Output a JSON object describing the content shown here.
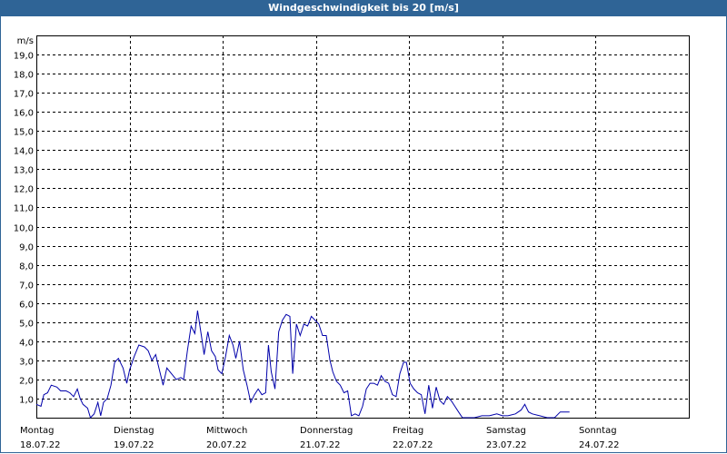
{
  "chart_data": {
    "type": "line",
    "title": "Windgeschwindigkeit bis 20 [m/s]",
    "ylabel": "m/s",
    "ylim": [
      0,
      20
    ],
    "yticks": [
      "1,0",
      "2,0",
      "3,0",
      "4,0",
      "5,0",
      "6,0",
      "7,0",
      "8,0",
      "9,0",
      "10,0",
      "11,0",
      "12,0",
      "13,0",
      "14,0",
      "15,0",
      "16,0",
      "17,0",
      "18,0",
      "19,0"
    ],
    "xlim": [
      0,
      7
    ],
    "x_categories": [
      {
        "day": "Montag",
        "date": "18.07.22"
      },
      {
        "day": "Dienstag",
        "date": "19.07.22"
      },
      {
        "day": "Mittwoch",
        "date": "20.07.22"
      },
      {
        "day": "Donnerstag",
        "date": "21.07.22"
      },
      {
        "day": "Freitag",
        "date": "22.07.22"
      },
      {
        "day": "Samstag",
        "date": "23.07.22"
      },
      {
        "day": "Sonntag",
        "date": "24.07.22"
      }
    ],
    "grid": true,
    "line_color": "#0000aa",
    "series": [
      {
        "x_unit": "days since Montag 18.07.22",
        "points": [
          [
            0.0,
            0.7
          ],
          [
            0.05,
            0.6
          ],
          [
            0.08,
            1.2
          ],
          [
            0.12,
            1.3
          ],
          [
            0.16,
            1.7
          ],
          [
            0.22,
            1.6
          ],
          [
            0.26,
            1.4
          ],
          [
            0.32,
            1.4
          ],
          [
            0.36,
            1.3
          ],
          [
            0.4,
            1.1
          ],
          [
            0.44,
            1.5
          ],
          [
            0.47,
            1.0
          ],
          [
            0.5,
            0.7
          ],
          [
            0.55,
            0.5
          ],
          [
            0.58,
            0.0
          ],
          [
            0.62,
            0.2
          ],
          [
            0.66,
            0.8
          ],
          [
            0.69,
            0.1
          ],
          [
            0.72,
            0.8
          ],
          [
            0.76,
            1.0
          ],
          [
            0.8,
            1.7
          ],
          [
            0.84,
            2.9
          ],
          [
            0.88,
            3.1
          ],
          [
            0.93,
            2.6
          ],
          [
            0.97,
            1.8
          ],
          [
            1.0,
            2.5
          ],
          [
            1.05,
            3.2
          ],
          [
            1.1,
            3.8
          ],
          [
            1.16,
            3.7
          ],
          [
            1.2,
            3.5
          ],
          [
            1.24,
            3.0
          ],
          [
            1.28,
            3.3
          ],
          [
            1.32,
            2.5
          ],
          [
            1.36,
            1.7
          ],
          [
            1.4,
            2.6
          ],
          [
            1.45,
            2.3
          ],
          [
            1.5,
            2.0
          ],
          [
            1.55,
            2.1
          ],
          [
            1.58,
            2.0
          ],
          [
            1.62,
            3.5
          ],
          [
            1.66,
            4.8
          ],
          [
            1.7,
            4.4
          ],
          [
            1.73,
            5.6
          ],
          [
            1.77,
            4.3
          ],
          [
            1.8,
            3.3
          ],
          [
            1.84,
            4.5
          ],
          [
            1.88,
            3.5
          ],
          [
            1.92,
            3.2
          ],
          [
            1.95,
            2.5
          ],
          [
            1.99,
            2.3
          ],
          [
            2.03,
            3.2
          ],
          [
            2.07,
            4.3
          ],
          [
            2.11,
            3.8
          ],
          [
            2.14,
            3.1
          ],
          [
            2.18,
            4.0
          ],
          [
            2.22,
            2.5
          ],
          [
            2.26,
            1.7
          ],
          [
            2.3,
            0.8
          ],
          [
            2.34,
            1.2
          ],
          [
            2.38,
            1.5
          ],
          [
            2.42,
            1.2
          ],
          [
            2.46,
            1.3
          ],
          [
            2.49,
            3.8
          ],
          [
            2.52,
            2.4
          ],
          [
            2.56,
            1.5
          ],
          [
            2.6,
            4.5
          ],
          [
            2.64,
            5.1
          ],
          [
            2.68,
            5.4
          ],
          [
            2.72,
            5.3
          ],
          [
            2.75,
            2.3
          ],
          [
            2.79,
            4.9
          ],
          [
            2.83,
            4.3
          ],
          [
            2.87,
            4.9
          ],
          [
            2.91,
            4.8
          ],
          [
            2.95,
            5.3
          ],
          [
            2.99,
            5.1
          ],
          [
            3.03,
            4.9
          ],
          [
            3.07,
            4.3
          ],
          [
            3.11,
            4.3
          ],
          [
            3.15,
            3.0
          ],
          [
            3.18,
            2.4
          ],
          [
            3.22,
            1.9
          ],
          [
            3.26,
            1.7
          ],
          [
            3.3,
            1.3
          ],
          [
            3.34,
            1.4
          ],
          [
            3.38,
            0.1
          ],
          [
            3.42,
            0.2
          ],
          [
            3.46,
            0.1
          ],
          [
            3.5,
            0.6
          ],
          [
            3.54,
            1.5
          ],
          [
            3.58,
            1.8
          ],
          [
            3.62,
            1.8
          ],
          [
            3.66,
            1.7
          ],
          [
            3.7,
            2.2
          ],
          [
            3.74,
            1.9
          ],
          [
            3.78,
            1.8
          ],
          [
            3.82,
            1.2
          ],
          [
            3.86,
            1.1
          ],
          [
            3.9,
            2.3
          ],
          [
            3.94,
            2.9
          ],
          [
            3.97,
            2.9
          ],
          [
            4.01,
            1.8
          ],
          [
            4.05,
            1.5
          ],
          [
            4.09,
            1.3
          ],
          [
            4.13,
            1.2
          ],
          [
            4.17,
            0.2
          ],
          [
            4.21,
            1.7
          ],
          [
            4.25,
            0.5
          ],
          [
            4.29,
            1.6
          ],
          [
            4.33,
            0.9
          ],
          [
            4.37,
            0.7
          ],
          [
            4.41,
            1.1
          ],
          [
            4.45,
            0.9
          ],
          [
            4.49,
            0.6
          ],
          [
            4.53,
            0.3
          ],
          [
            4.57,
            0.0
          ],
          [
            4.62,
            0.0
          ],
          [
            4.7,
            0.0
          ],
          [
            4.78,
            0.1
          ],
          [
            4.86,
            0.1
          ],
          [
            4.94,
            0.2
          ],
          [
            5.0,
            0.1
          ],
          [
            5.06,
            0.1
          ],
          [
            5.14,
            0.2
          ],
          [
            5.2,
            0.4
          ],
          [
            5.24,
            0.7
          ],
          [
            5.28,
            0.3
          ],
          [
            5.32,
            0.2
          ],
          [
            5.4,
            0.1
          ],
          [
            5.48,
            0.0
          ],
          [
            5.56,
            0.0
          ],
          [
            5.62,
            0.3
          ],
          [
            5.72,
            0.3
          ]
        ]
      }
    ]
  }
}
